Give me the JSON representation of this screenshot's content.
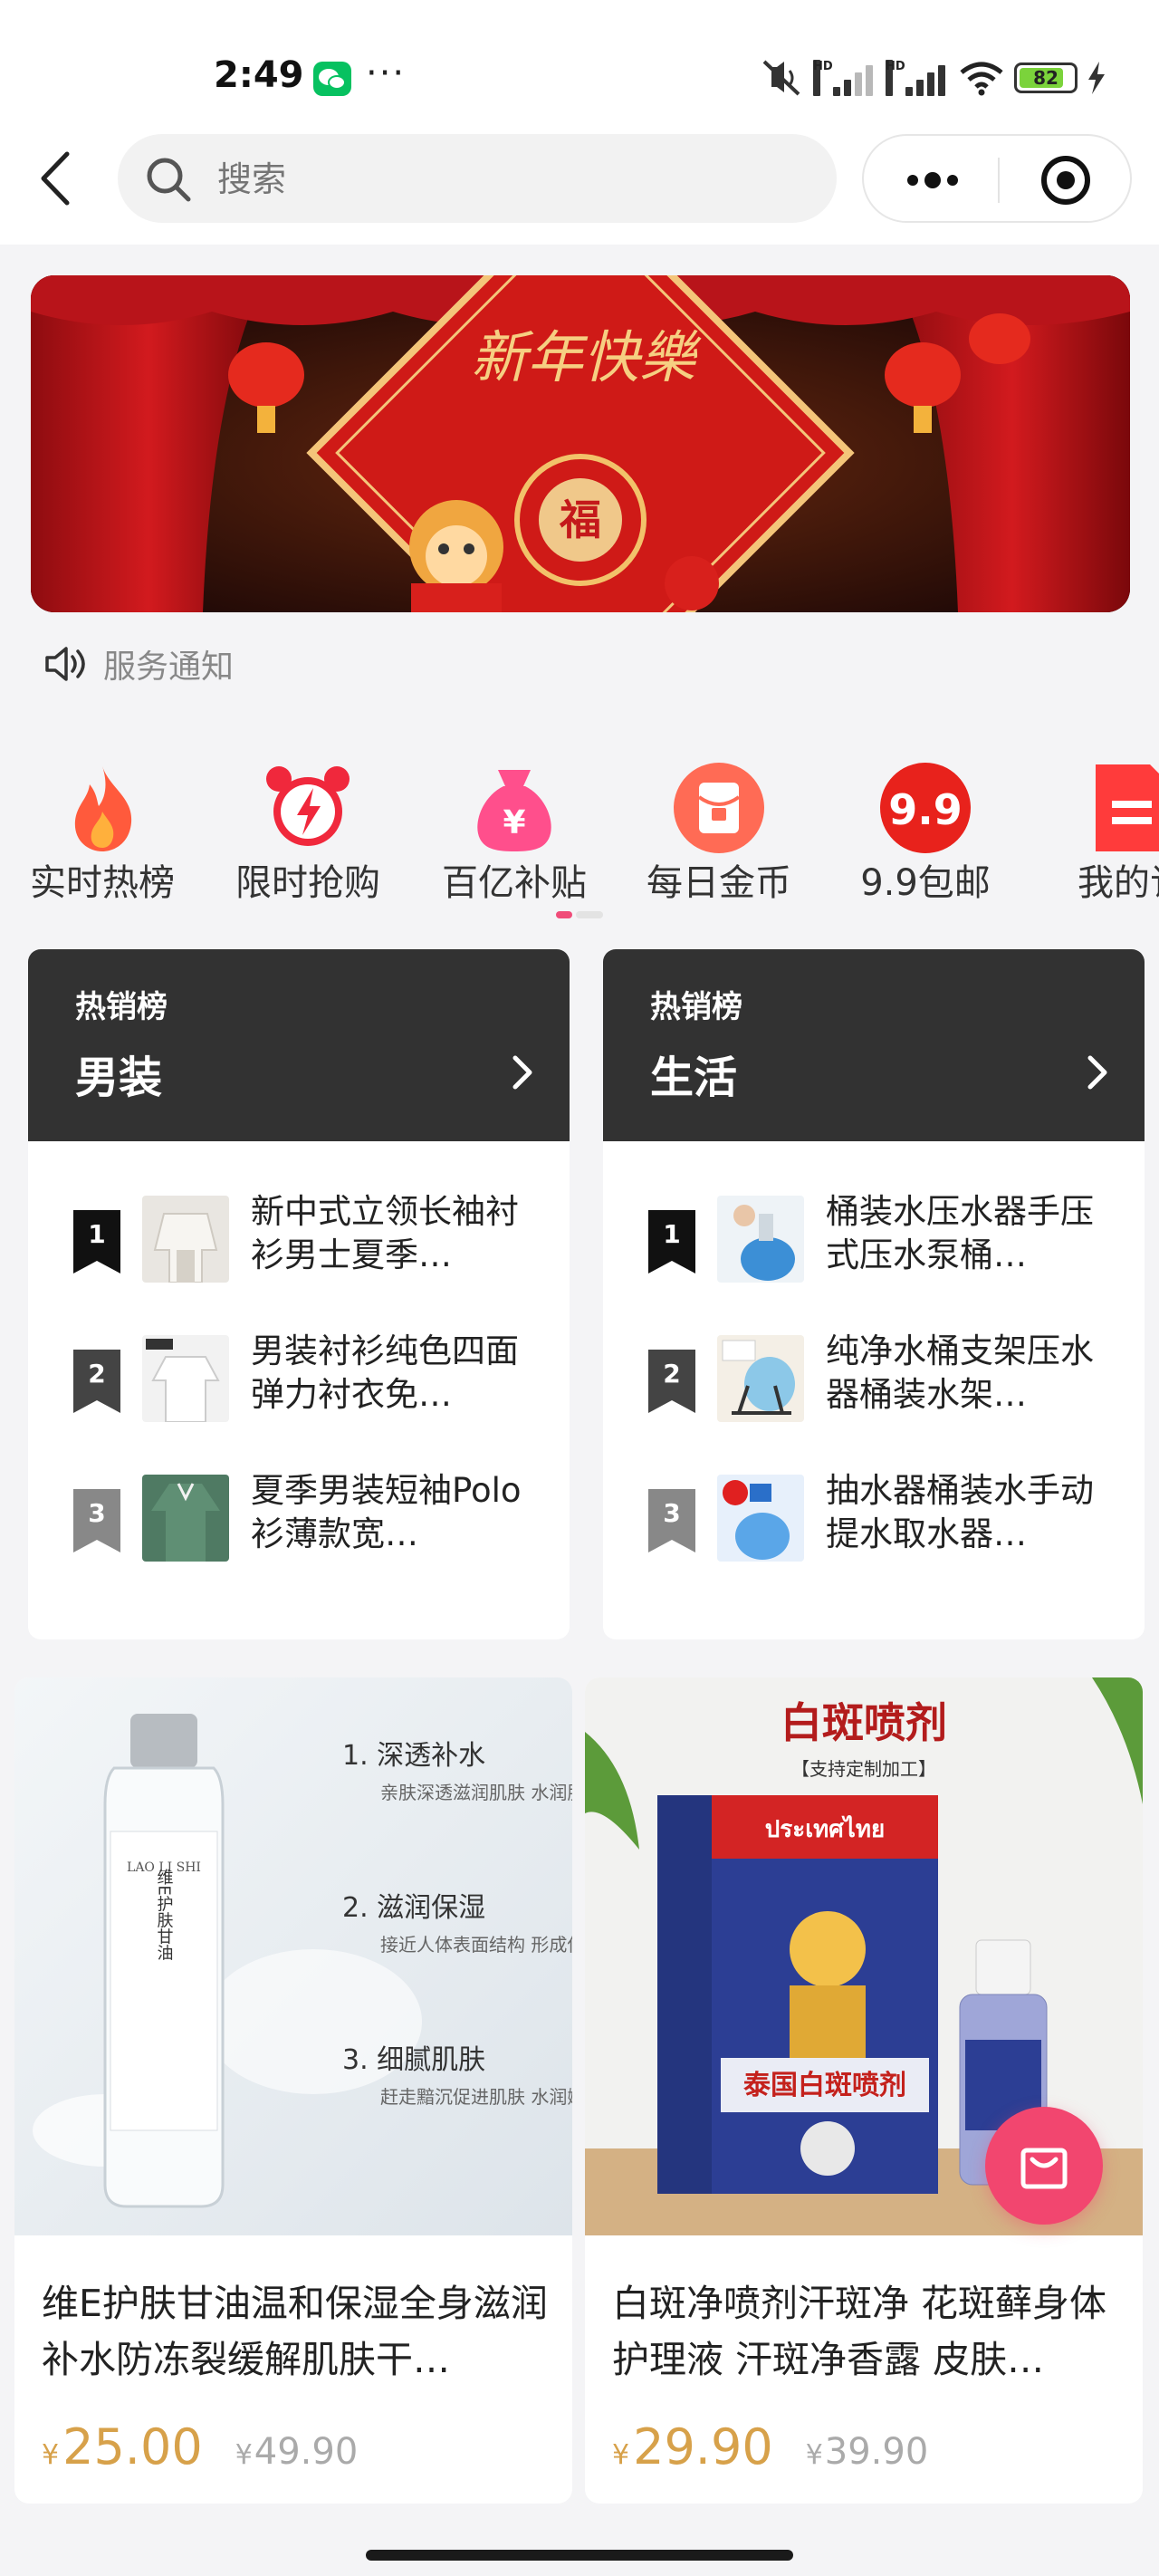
{
  "status_bar": {
    "time": "2:49",
    "wechat_icon": "wechat-icon",
    "more": "···",
    "signal1_tag": "HD",
    "signal2_tag": "HD",
    "battery": "82",
    "battery_level": 0.82
  },
  "nav": {
    "search_placeholder": "搜索"
  },
  "notice": {
    "text": "服务通知"
  },
  "shortcuts": [
    {
      "label": "实时热榜",
      "icon": "flame-icon",
      "color": "#ff5a3c"
    },
    {
      "label": "限时抢购",
      "icon": "alarm-clock-icon",
      "color": "#f0283c"
    },
    {
      "label": "百亿补贴",
      "icon": "money-bag-icon",
      "color": "#ff4f8c"
    },
    {
      "label": "每日金币",
      "icon": "red-envelope-icon",
      "color": "#ff5a4a"
    },
    {
      "label": "9.9包邮",
      "icon": "9.9-badge-icon",
      "badge": "9.9",
      "color": "#e8221c"
    },
    {
      "label": "我的订",
      "icon": "order-doc-icon",
      "color": "#ff3b3b"
    }
  ],
  "rank_cards": [
    {
      "tag": "热销榜",
      "title": "男装",
      "items": [
        {
          "rank": "1",
          "text": "新中式立领长袖衬衫男士夏季…"
        },
        {
          "rank": "2",
          "text": "男装衬衫纯色四面弹力衬衣免…"
        },
        {
          "rank": "3",
          "text": "夏季男装短袖Polo衫薄款宽…"
        }
      ]
    },
    {
      "tag": "热销榜",
      "title": "生活",
      "items": [
        {
          "rank": "1",
          "text": "桶装水压水器手压式压水泵桶…"
        },
        {
          "rank": "2",
          "text": "纯净水桶支架压水器桶装水架…"
        },
        {
          "rank": "3",
          "text": "抽水器桶装水手动提水取水器…"
        }
      ]
    }
  ],
  "products": [
    {
      "title": "维E护肤甘油温和保湿全身滋润补水防冻裂缓解肌肤干…",
      "currency": "¥",
      "price": "25.00",
      "old_currency": "¥",
      "old_price": "49.90",
      "image": {
        "brand": "LAO LI SHI",
        "bottle_label": "维E护肤甘油",
        "points": [
          {
            "no": "1.",
            "title": "深透补水",
            "sub": "亲肤深透滋润肌肤 水润肌底"
          },
          {
            "no": "2.",
            "title": "滋润保湿",
            "sub": "接近人体表面结构 形成保湿屏障"
          },
          {
            "no": "3.",
            "title": "细腻肌肤",
            "sub": "赶走黯沉促进肌肤 水润嫩滑"
          }
        ]
      }
    },
    {
      "title": "白斑净喷剂汗斑净 花斑藓身体护理液 汗斑净香露 皮肤…",
      "currency": "¥",
      "price": "29.90",
      "old_currency": "¥",
      "old_price": "39.90",
      "image": {
        "headline": "白斑喷剂",
        "subline": "【支持定制加工】",
        "box_brand": "ประเทศไทย",
        "box_title": "泰国白斑喷剂"
      }
    }
  ]
}
